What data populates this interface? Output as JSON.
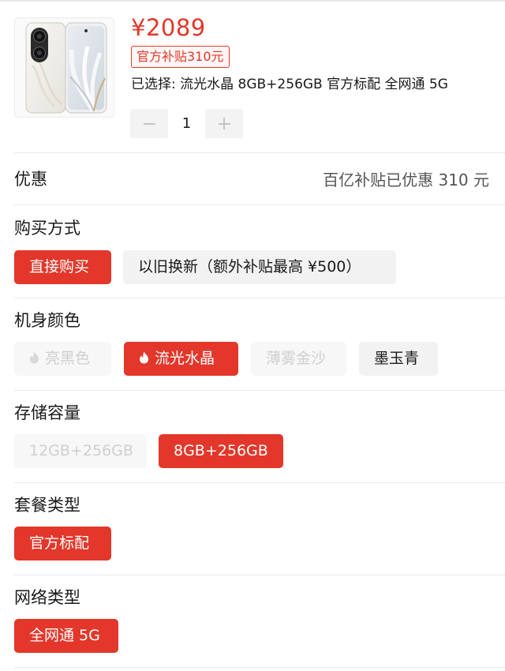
{
  "product": {
    "price": "¥2089",
    "subsidy_tag": "官方补贴310元",
    "selected": "已选择: 流光水晶 8GB+256GB 官方标配 全网通 5G",
    "quantity": "1"
  },
  "promo": {
    "title": "优惠",
    "detail": "百亿补贴已优惠 310 元"
  },
  "purchase": {
    "title": "购买方式",
    "options": [
      "直接购买",
      "以旧换新（额外补贴最高 ¥500）"
    ]
  },
  "color": {
    "title": "机身颜色",
    "options": [
      "亮黑色",
      "流光水晶",
      "薄雾金沙",
      "墨玉青"
    ]
  },
  "storage": {
    "title": "存储容量",
    "options": [
      "12GB+256GB",
      "8GB+256GB"
    ]
  },
  "package": {
    "title": "套餐类型",
    "options": [
      "官方标配"
    ]
  },
  "network": {
    "title": "网络类型",
    "options": [
      "全网通 5G"
    ]
  },
  "colors": {
    "accent": "#e2372a",
    "chip_bg": "#f2f2f2",
    "disabled_text": "#cfcfcf"
  }
}
